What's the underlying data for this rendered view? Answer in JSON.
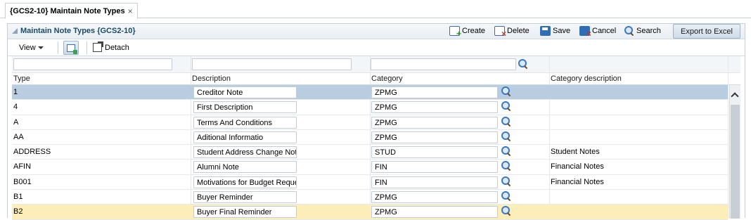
{
  "tab": {
    "title": "{GCS2-10} Maintain Note Types",
    "close": "×"
  },
  "panel": {
    "title": "Maintain Note Types {GCS2-10}"
  },
  "toolbar": {
    "create": "Create",
    "delete": "Delete",
    "save": "Save",
    "cancel": "Cancel",
    "search": "Search",
    "export": "Export to Excel",
    "view": "View",
    "detach": "Detach"
  },
  "columns": {
    "type": "Type",
    "description": "Description",
    "category": "Category",
    "category_description": "Category description"
  },
  "rows": [
    {
      "type": "1",
      "description": "Creditor Note",
      "category": "ZPMG",
      "category_description": "",
      "state": "selected"
    },
    {
      "type": "4",
      "description": "First Description",
      "category": "ZPMG",
      "category_description": ""
    },
    {
      "type": "A",
      "description": "Terms And Conditions",
      "category": "ZPMG",
      "category_description": ""
    },
    {
      "type": "AA",
      "description": "Aditional Informatio",
      "category": "ZPMG",
      "category_description": ""
    },
    {
      "type": "ADDRESS",
      "description": "Student Address Change Not",
      "category": "STUD",
      "category_description": "Student Notes"
    },
    {
      "type": "AFIN",
      "description": "Alumni Note",
      "category": "FIN",
      "category_description": "Financial Notes"
    },
    {
      "type": "B001",
      "description": "Motivations for Budget Reque",
      "category": "FIN",
      "category_description": "Financial Notes"
    },
    {
      "type": "B1",
      "description": "Buyer Reminder",
      "category": "ZPMG",
      "category_description": ""
    },
    {
      "type": "B2",
      "description": "Buyer Final Reminder",
      "category": "ZPMG",
      "category_description": "",
      "state": "highlighted"
    }
  ]
}
